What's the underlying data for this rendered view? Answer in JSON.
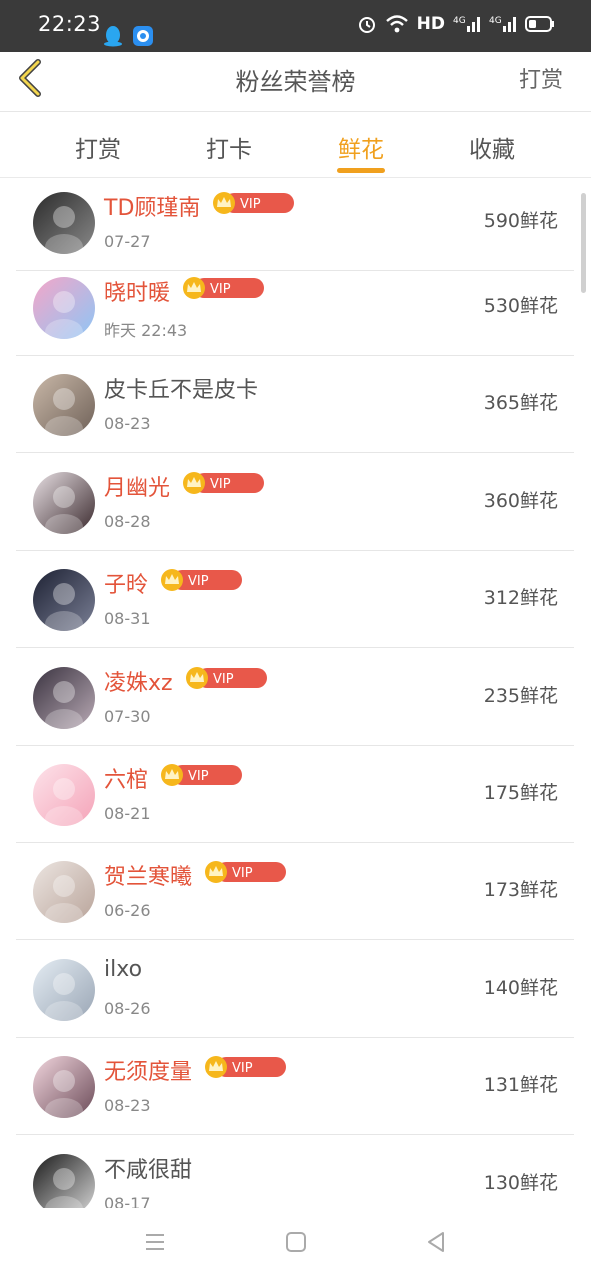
{
  "status": {
    "time": "22:23",
    "hd": "HD",
    "signal1": "4G",
    "signal2": "4G"
  },
  "header": {
    "title": "粉丝荣誉榜",
    "right_label": "打赏"
  },
  "tabs": [
    {
      "label": "打赏"
    },
    {
      "label": "打卡"
    },
    {
      "label": "鲜花"
    },
    {
      "label": "收藏"
    }
  ],
  "active_tab": "鲜花",
  "vip_label": "VIP",
  "colors": {
    "accent": "#f0a01e",
    "vip_name": "#e3543a",
    "vip_badge": "#e8584a",
    "crown": "#f6b71c"
  },
  "fans": [
    {
      "name": "TD顾瑾南",
      "vip": true,
      "date": "07-27",
      "flowers": "590鲜花"
    },
    {
      "name": "晓时暖",
      "vip": true,
      "date": "昨天 22:43",
      "flowers": "530鲜花"
    },
    {
      "name": "皮卡丘不是皮卡",
      "vip": false,
      "date": "08-23",
      "flowers": "365鲜花"
    },
    {
      "name": "月幽光",
      "vip": true,
      "date": "08-28",
      "flowers": "360鲜花"
    },
    {
      "name": "子昤",
      "vip": true,
      "date": "08-31",
      "flowers": "312鲜花"
    },
    {
      "name": "凌姝xz",
      "vip": true,
      "date": "07-30",
      "flowers": "235鲜花"
    },
    {
      "name": "六棺",
      "vip": true,
      "date": "08-21",
      "flowers": "175鲜花"
    },
    {
      "name": "贺兰寒曦",
      "vip": true,
      "date": "06-26",
      "flowers": "173鲜花"
    },
    {
      "name": "ilxo",
      "vip": false,
      "date": "08-26",
      "flowers": "140鲜花"
    },
    {
      "name": "无须度量",
      "vip": true,
      "date": "08-23",
      "flowers": "131鲜花"
    },
    {
      "name": "不咸很甜",
      "vip": false,
      "date": "08-17",
      "flowers": "130鲜花"
    }
  ]
}
